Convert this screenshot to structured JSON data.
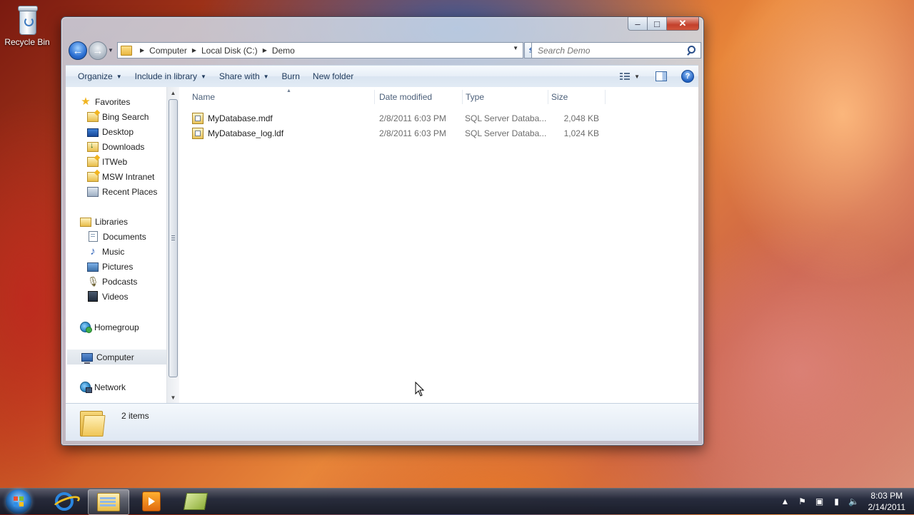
{
  "desktop": {
    "icons": [
      {
        "label": "Recycle Bin",
        "icon": "recycle-bin-icon"
      }
    ]
  },
  "window": {
    "caption": {
      "minimize": "–",
      "maximize": "□",
      "close": "✕"
    },
    "navigation": {
      "back": "←",
      "forward": "→"
    },
    "address": {
      "crumbs": [
        "Computer",
        "Local Disk (C:)",
        "Demo"
      ]
    },
    "search": {
      "placeholder": "Search Demo"
    },
    "toolbar": {
      "organize": "Organize",
      "include_in_library": "Include in library",
      "share_with": "Share with",
      "burn": "Burn",
      "new_folder": "New folder",
      "help": "?"
    },
    "nav_pane": {
      "favorites": {
        "label": "Favorites",
        "items": [
          "Bing Search",
          "Desktop",
          "Downloads",
          "ITWeb",
          "MSW Intranet",
          "Recent Places"
        ]
      },
      "libraries": {
        "label": "Libraries",
        "items": [
          "Documents",
          "Music",
          "Pictures",
          "Podcasts",
          "Videos"
        ]
      },
      "homegroup": "Homegroup",
      "computer": "Computer",
      "network": "Network",
      "selected": "Computer"
    },
    "columns": [
      "Name",
      "Date modified",
      "Type",
      "Size"
    ],
    "files": [
      {
        "name": "MyDatabase.mdf",
        "date_modified": "2/8/2011 6:03 PM",
        "type": "SQL Server Databa...",
        "size": "2,048 KB"
      },
      {
        "name": "MyDatabase_log.ldf",
        "date_modified": "2/8/2011 6:03 PM",
        "type": "SQL Server Databa...",
        "size": "1,024 KB"
      }
    ],
    "details": {
      "item_count": "2 items"
    }
  },
  "taskbar": {
    "pinned": [
      "start-orb",
      "internet-explorer-icon",
      "windows-explorer-icon",
      "media-player-icon",
      "sql-server-icon"
    ],
    "active": "windows-explorer-icon",
    "clock": {
      "time": "8:03 PM",
      "date": "2/14/2011"
    }
  },
  "colors": {
    "window_glass": "#c8d9ec",
    "command_bar_text": "#1e395b",
    "secondary_text": "#6d6d6d",
    "close_button": "#c4412c"
  }
}
